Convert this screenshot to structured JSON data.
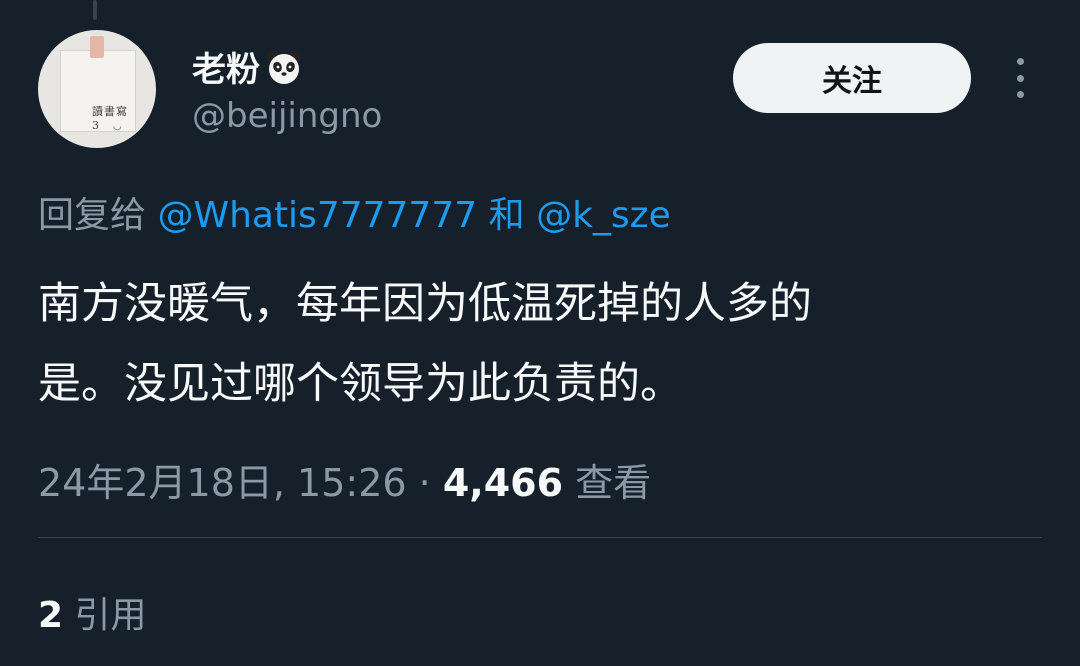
{
  "user": {
    "display_name": "老粉",
    "handle": "@beijingno"
  },
  "follow_button_label": "关注",
  "reply": {
    "prefix": "回复给",
    "mention1": "@Whatis7777777",
    "conjunction": "和",
    "mention2": "@k_sze"
  },
  "tweet": {
    "line1": "南方没暖气，每年因为低温死掉的人多的",
    "line2": "是。没见过哪个领导为此负责的。"
  },
  "meta": {
    "timestamp": "24年2月18日, 15:26",
    "separator": "·",
    "views": "4,466",
    "views_label": "查看"
  },
  "quotes": {
    "count": "2",
    "label": "引用"
  },
  "colors": {
    "background": "#15202b",
    "accent": "#1d9bf0",
    "secondary_text": "#8b98a5",
    "primary_text": "#f7f9f9"
  }
}
